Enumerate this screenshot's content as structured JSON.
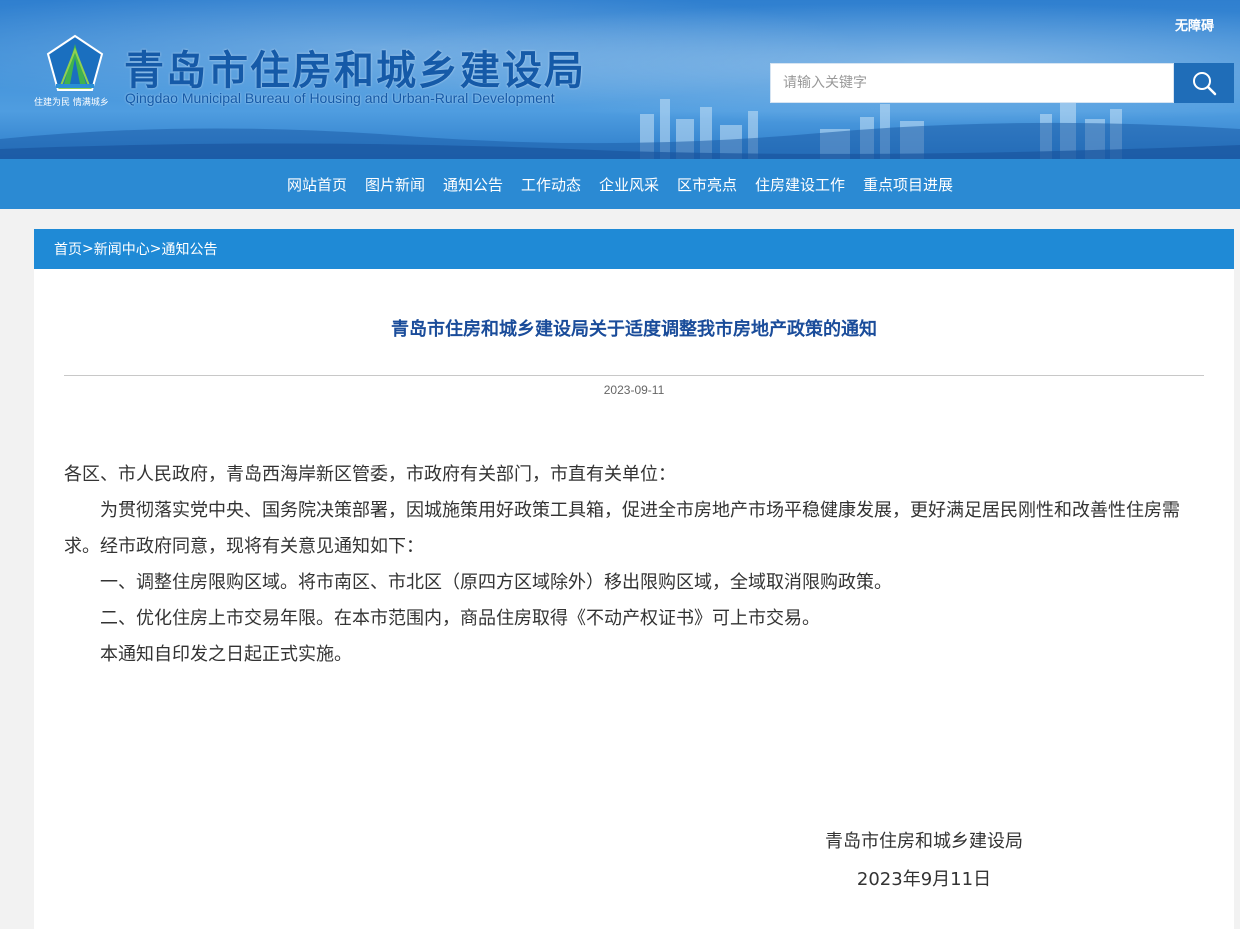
{
  "header": {
    "site_title": "青岛市住房和城乡建设局",
    "site_subtitle": "Qingdao Municipal Bureau of Housing and Urban-Rural Development",
    "slogan": "住建为民 情满城乡",
    "accessibility": "无障碍",
    "search": {
      "placeholder": "请输入关键字"
    }
  },
  "nav": {
    "items": [
      {
        "label": "网站首页"
      },
      {
        "label": "图片新闻"
      },
      {
        "label": "通知公告"
      },
      {
        "label": "工作动态"
      },
      {
        "label": "企业风采"
      },
      {
        "label": "区市亮点"
      },
      {
        "label": "住房建设工作"
      },
      {
        "label": "重点项目进展"
      }
    ]
  },
  "breadcrumb": {
    "items": [
      "首页",
      "新闻中心",
      "通知公告"
    ],
    "separator": ">"
  },
  "article": {
    "title": "青岛市住房和城乡建设局关于适度调整我市房地产政策的通知",
    "date": "2023-09-11",
    "paragraphs": [
      "各区、市人民政府，青岛西海岸新区管委，市政府有关部门，市直有关单位：",
      "为贯彻落实党中央、国务院决策部署，因城施策用好政策工具箱，促进全市房地产市场平稳健康发展，更好满足居民刚性和改善性住房需求。经市政府同意，现将有关意见通知如下：",
      "一、调整住房限购区域。将市南区、市北区（原四方区域除外）移出限购区域，全域取消限购政策。",
      "二、优化住房上市交易年限。在本市范围内，商品住房取得《不动产权证书》可上市交易。",
      "本通知自印发之日起正式实施。"
    ],
    "signature": {
      "org": "青岛市住房和城乡建设局",
      "date": "2023年9月11日"
    }
  },
  "colors": {
    "nav_bg": "#2b8ad3",
    "breadcrumb_bg": "#1f8ad6",
    "title_color": "#1a4c9a",
    "search_button": "#1f6db8"
  }
}
